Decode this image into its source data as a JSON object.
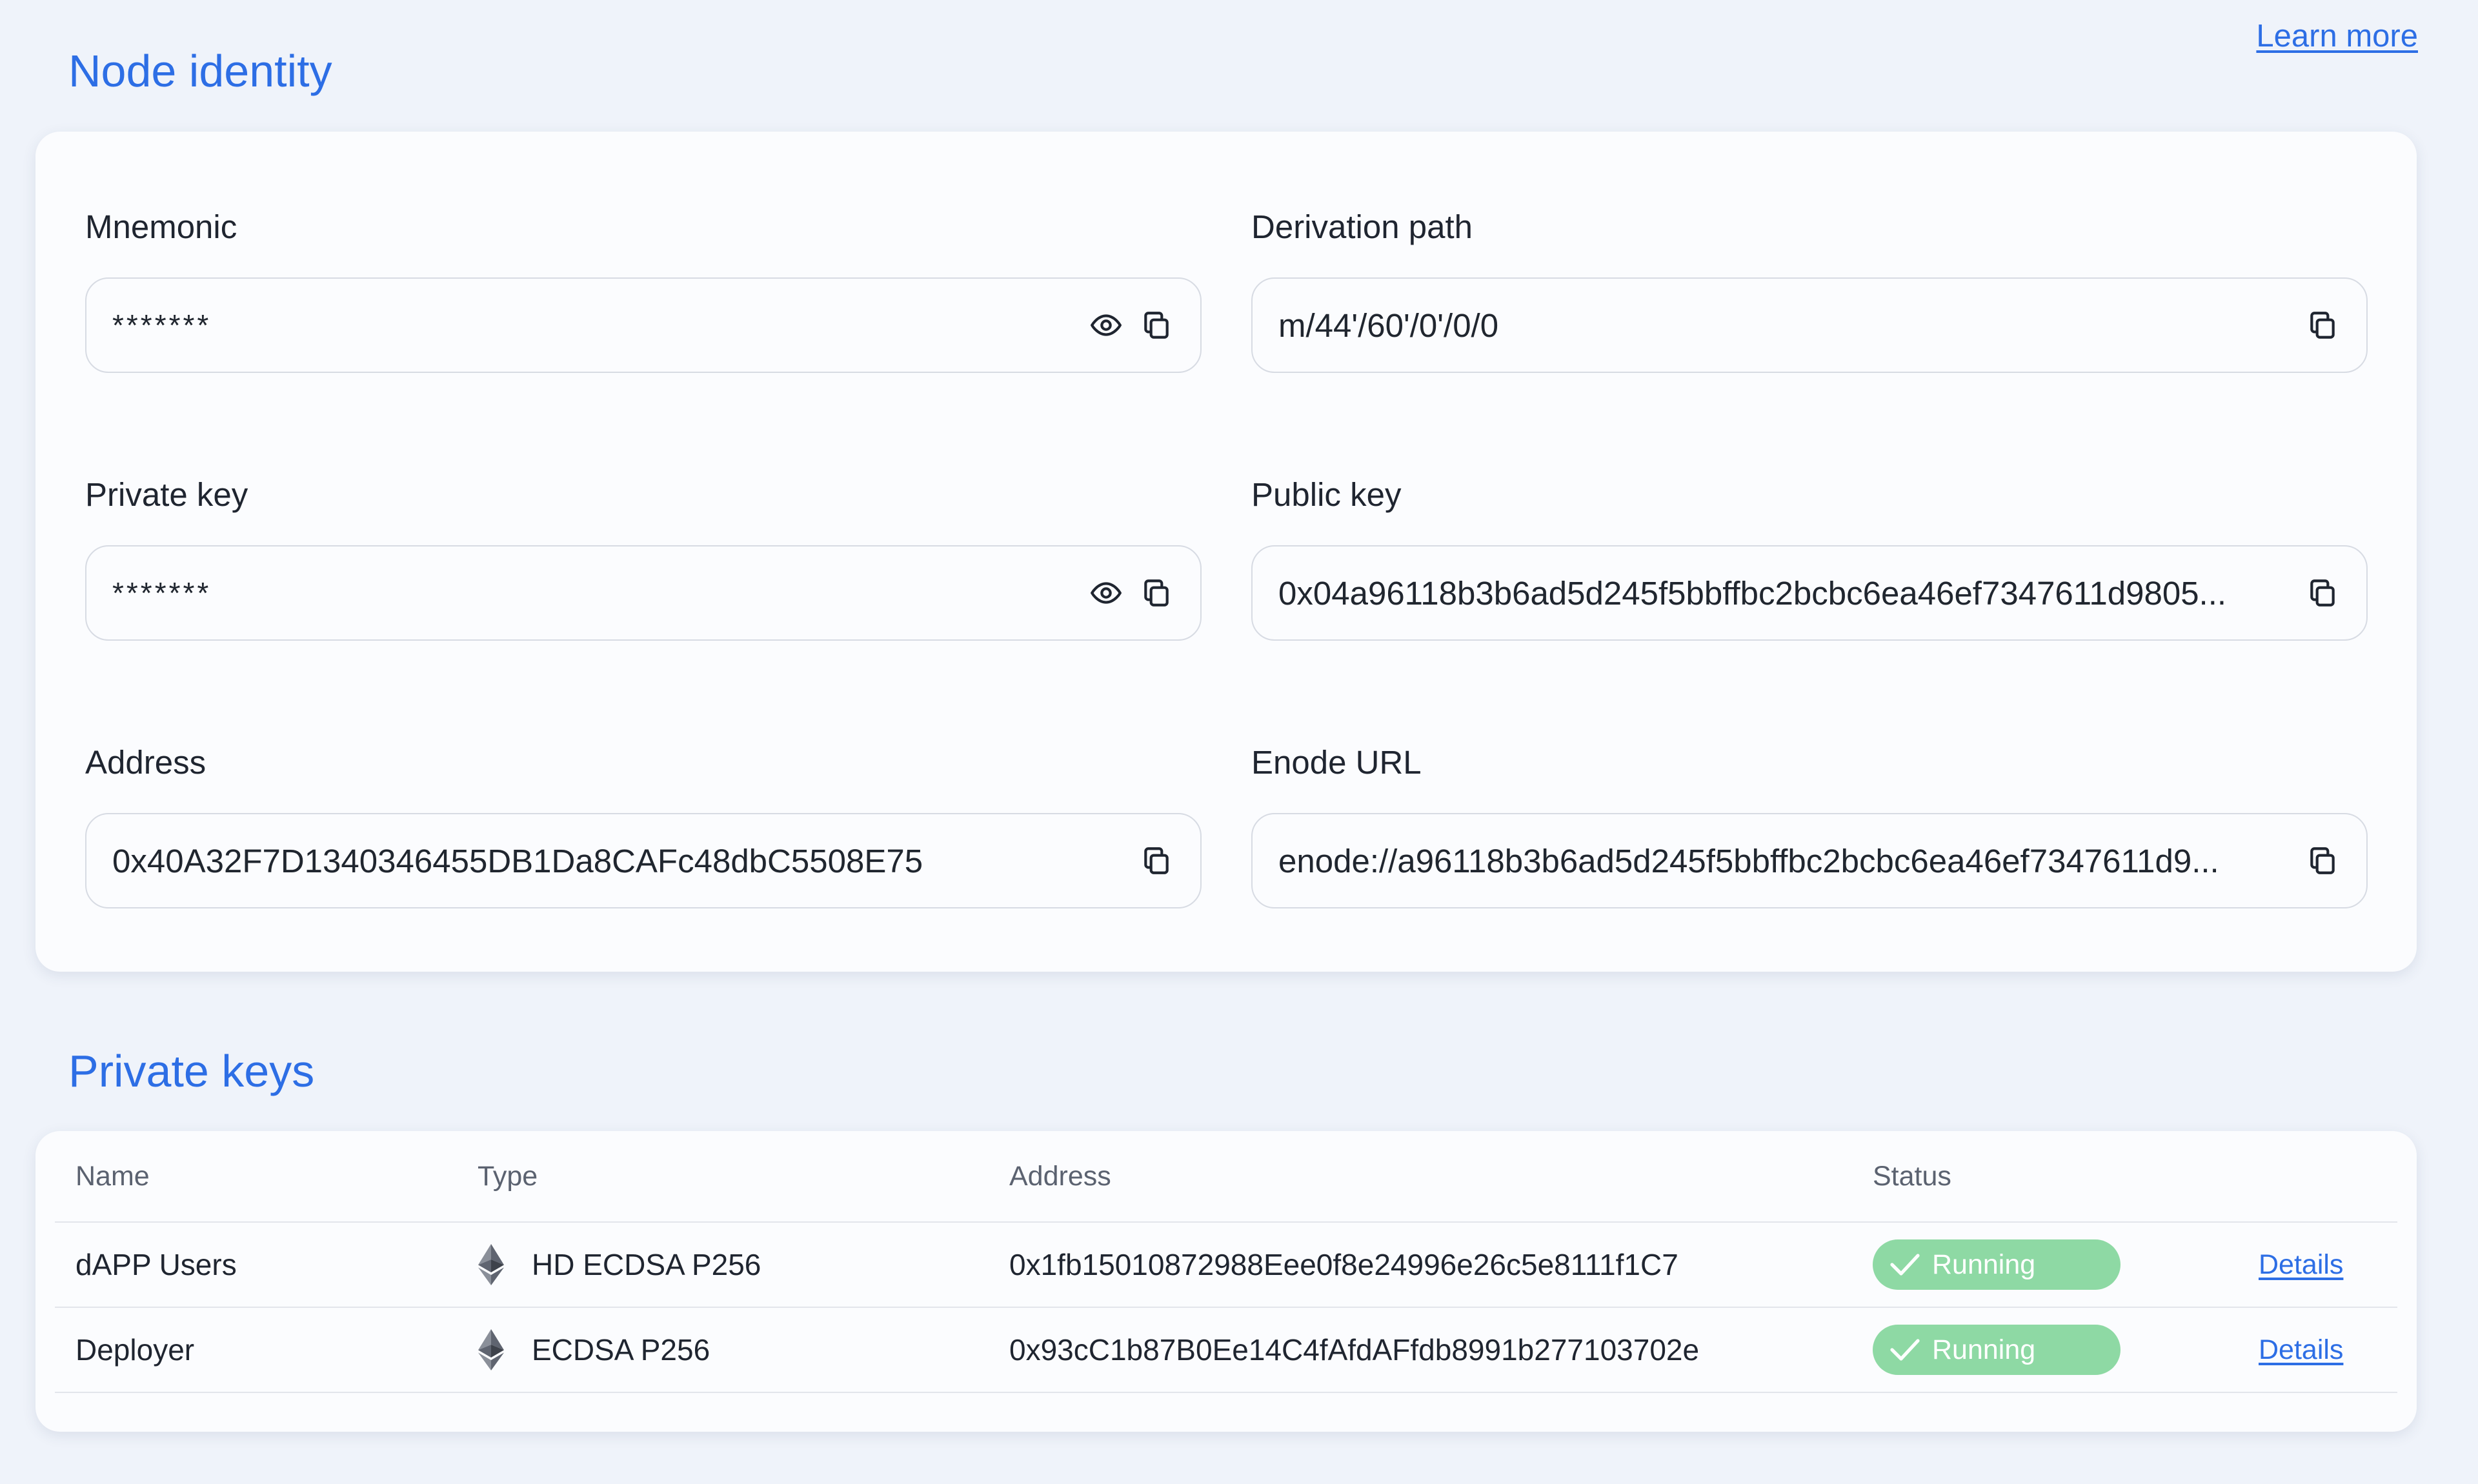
{
  "header": {
    "learn_more": "Learn more"
  },
  "node_identity": {
    "title": "Node identity",
    "fields": {
      "mnemonic": {
        "label": "Mnemonic",
        "value": "*******"
      },
      "derivation_path": {
        "label": "Derivation path",
        "value": "m/44'/60'/0'/0/0"
      },
      "private_key": {
        "label": "Private key",
        "value": "*******"
      },
      "public_key": {
        "label": "Public key",
        "value": "0x04a96118b3b6ad5d245f5bbffbc2bcbc6ea46ef7347611d9805..."
      },
      "address": {
        "label": "Address",
        "value": "0x40A32F7D1340346455DB1Da8CAFc48dbC5508E75"
      },
      "enode_url": {
        "label": "Enode URL",
        "value": "enode://a96118b3b6ad5d245f5bbffbc2bcbc6ea46ef7347611d9..."
      }
    }
  },
  "private_keys": {
    "title": "Private keys",
    "columns": [
      "Name",
      "Type",
      "Address",
      "Status"
    ],
    "rows": [
      {
        "name": "dAPP Users",
        "type": "HD ECDSA P256",
        "address": "0x1fb15010872988Eee0f8e24996e26c5e8111f1C7",
        "status": "Running",
        "action": "Details"
      },
      {
        "name": "Deployer",
        "type": "ECDSA P256",
        "address": "0x93cC1b87B0Ee14C4fAfdAFfdb8991b277103702e",
        "status": "Running",
        "action": "Details"
      }
    ]
  },
  "icons": {
    "reveal": "eye-icon",
    "copy": "copy-icon",
    "type": "ethereum-icon",
    "status": "check-icon"
  },
  "colors": {
    "accent": "#2d6ee5",
    "status_running": "#8ed9a4",
    "background": "#eff3fa"
  }
}
